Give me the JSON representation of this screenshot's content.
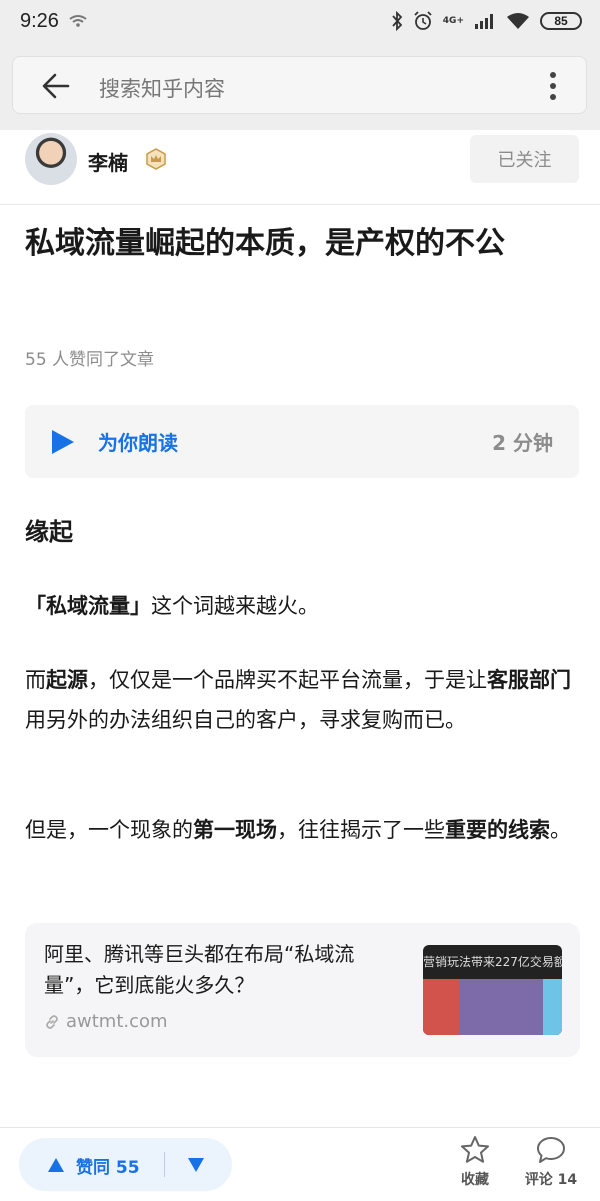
{
  "status_bar": {
    "time": "9:26",
    "network_top": "4G+",
    "battery": "85"
  },
  "search": {
    "placeholder": "搜索知乎内容"
  },
  "author": {
    "name": "李楠",
    "follow_label": "已关注"
  },
  "article": {
    "title": "私域流量崛起的本质，是产权的不公",
    "likes_line": "55 人赞同了文章",
    "read_aloud": {
      "label": "为你朗读",
      "duration": "2 分钟"
    },
    "section_heading": "缘起",
    "paragraph1": {
      "b1": "「私域流量」",
      "t1": "这个词越来越火。"
    },
    "paragraph2": {
      "t1": "而",
      "b1": "起源",
      "t2": "，仅仅是一个品牌买不起平台流量，于是让",
      "b2": "客服部门",
      "t3": "用另外的办法组织自己的客户，寻求复购而已。"
    },
    "paragraph3": {
      "t1": "但是，一个现象的",
      "b1": "第一现场",
      "t2": "，往往揭示了一些",
      "b2": "重要的线索",
      "t3": "。"
    },
    "link_card": {
      "title": "阿里、腾讯等巨头都在布局“私域流量”，它到底能火多久？",
      "url": "awtmt.com",
      "thumbnail_caption": "营销玩法带来227亿交易额"
    }
  },
  "bottom_bar": {
    "upvote_label": "赞同 55",
    "favorite_label": "收藏",
    "comment_label": "评论 14"
  },
  "colors": {
    "accent": "#1772e6",
    "muted": "#8c8c8c",
    "background": "#ffffff"
  },
  "icons": {
    "back": "arrow-left-icon",
    "more": "more-vertical-icon",
    "badge": "creator-badge-icon",
    "play": "play-icon",
    "link": "link-icon",
    "upvote": "triangle-up-icon",
    "downvote": "triangle-down-icon",
    "favorite": "star-icon",
    "comment": "comment-bubble-icon"
  }
}
